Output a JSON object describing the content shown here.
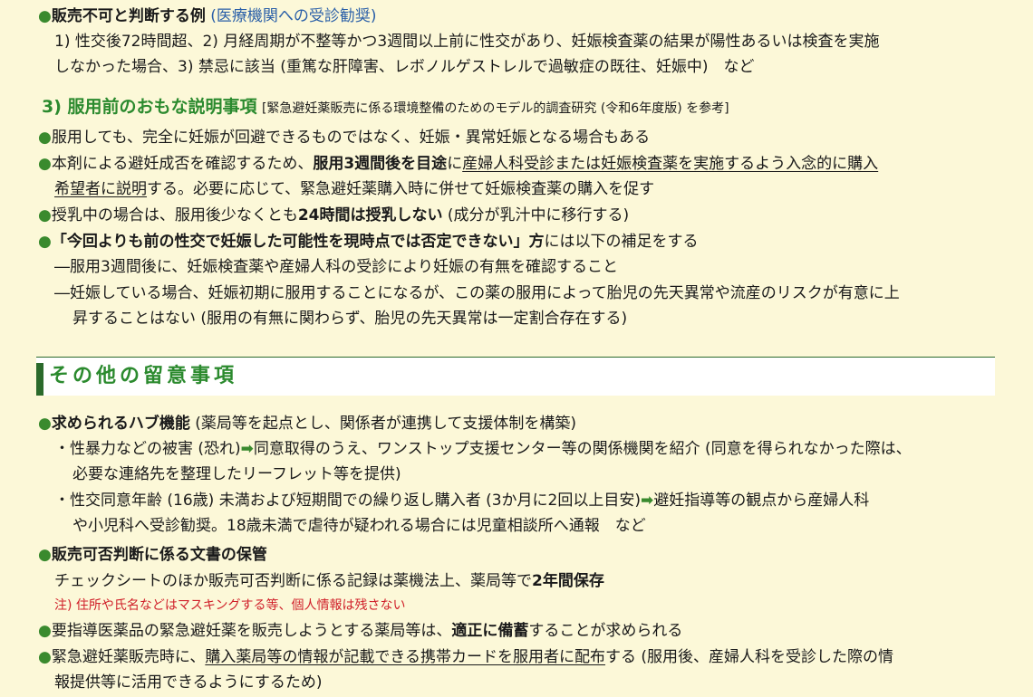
{
  "top": {
    "l1_head": "販売不可と判断する例",
    "l1_note": "(医療機関への受診勧奨)",
    "l2": "1) 性交後72時間超、2) 月経周期が不整等かつ3週間以上前に性交があり、妊娠検査薬の結果が陽性あるいは検査を実施",
    "l3": "しなかった場合、3) 禁忌に該当 (重篤な肝障害、レボノルゲストレルで過敏症の既往、妊娠中)　など"
  },
  "explain": {
    "heading": "3) 服用前のおもな説明事項",
    "heading_note": "[緊急避妊薬販売に係る環境整備のためのモデル的調査研究 (令和6年度版) を参考]",
    "b1": "服用しても、完全に妊娠が回避できるものではなく、妊娠・異常妊娠となる場合もある",
    "b2_a": "本剤による避妊成否を確認するため、",
    "b2_b": "服用3週間後を目途",
    "b2_c": "に",
    "b2_d": "産婦人科受診または妊娠検査薬を実施するよう入念的に購入",
    "b2_e": "希望者に説明",
    "b2_f": "する。必要に応じて、緊急避妊薬購入時に併せて妊娠検査薬の購入を促す",
    "b3_a": "授乳中の場合は、服用後少なくとも",
    "b3_b": "24時間は授乳しない",
    "b3_c": " (成分が乳汁中に移行する)",
    "b4_a": "「今回よりも前の性交で妊娠した可能性を現時点では否定できない」方",
    "b4_b": "には以下の補足をする",
    "d1": "―服用3週間後に、妊娠検査薬や産婦人科の受診により妊娠の有無を確認すること",
    "d2": "―妊娠している場合、妊娠初期に服用することになるが、この薬の服用によって胎児の先天異常や流産のリスクが有意に上",
    "d3": "昇することはない (服用の有無に関わらず、胎児の先天異常は一定割合存在する)"
  },
  "section": {
    "title": "その他の留意事項"
  },
  "other": {
    "h1_a": "求められるハブ機能",
    "h1_b": " (薬局等を起点とし、関係者が連携して支援体制を構築)",
    "s1_a": "・性暴力などの被害 (恐れ)",
    "s1_b": "同意取得のうえ、ワンストップ支援センター等の関係機関を紹介 (同意を得られなかった際は、",
    "s1_c": "必要な連絡先を整理したリーフレット等を提供)",
    "s2_a": "・性交同意年齢 (16歳) 未満および短期間での繰り返し購入者 (3か月に2回以上目安)",
    "s2_b": "避妊指導等の観点から産婦人科",
    "s2_c": "や小児科へ受診勧奨。18歳未満で虐待が疑われる場合には児童相談所へ通報　など",
    "h2": "販売可否判断に係る文書の保管",
    "h2_t_a": "チェックシートのほか販売可否判断に係る記録は薬機法上、薬局等で",
    "h2_t_b": "2年間保存",
    "note": "注) 住所や氏名などはマスキングする等、個人情報は残さない",
    "b5_a": "要指導医薬品の緊急避妊薬を販売しようとする薬局等は、",
    "b5_b": "適正に備蓄",
    "b5_c": "することが求められる",
    "b6_a": "緊急避妊薬販売時に、",
    "b6_b": "購入薬局等の情報が記載できる携帯カードを服用者に配布",
    "b6_c": "する (服用後、産婦人科を受診した際の情",
    "b6_d": "報提供等に活用できるようにするため)"
  },
  "colors": {
    "background": "#fcf8d8",
    "accent_green": "#2b8a2e",
    "note_red": "#d0202a",
    "link_blue": "#2a5fa8"
  },
  "icons": {
    "bullet": "●",
    "arrow": "➡"
  }
}
